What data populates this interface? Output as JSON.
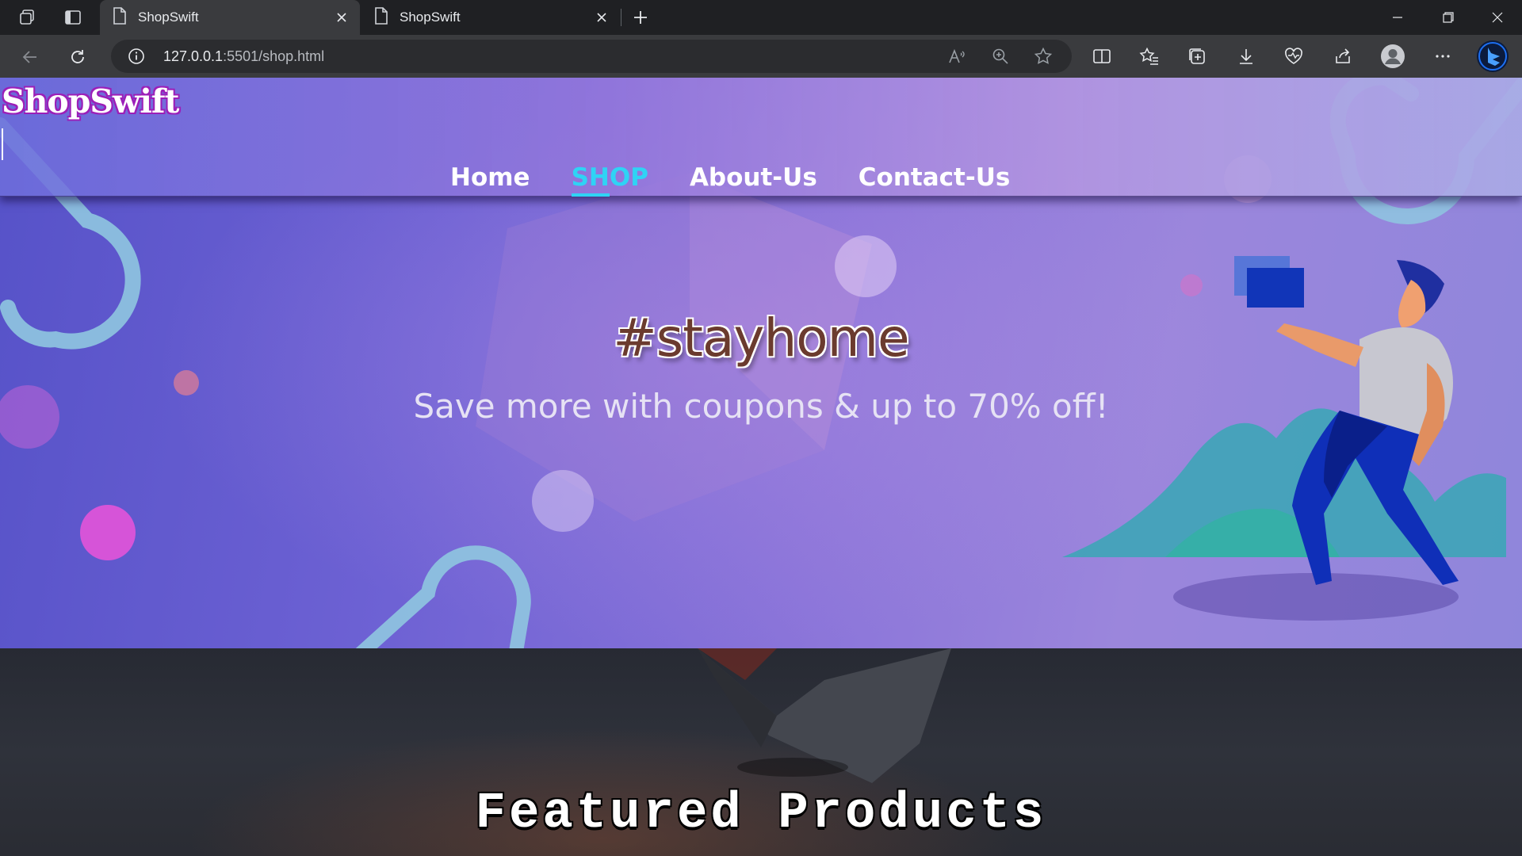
{
  "browser": {
    "tabs": [
      {
        "title": "ShopSwift",
        "active": true
      },
      {
        "title": "ShopSwift",
        "active": false
      }
    ],
    "url_host": "127.0.0.1",
    "url_path": ":5501/shop.html",
    "icons": [
      "workspaces-icon",
      "tab-actions-icon",
      "page-icon",
      "close-icon",
      "new-tab-icon",
      "minimize-icon",
      "restore-icon",
      "window-close-icon",
      "back-icon",
      "refresh-icon",
      "info-icon",
      "read-aloud-icon",
      "zoom-icon",
      "favorite-star-icon",
      "split-screen-icon",
      "favorites-icon",
      "collections-icon",
      "downloads-icon",
      "browser-essentials-icon",
      "share-icon",
      "profile-icon",
      "more-icon",
      "copilot-icon"
    ]
  },
  "site": {
    "logo": "ShopSwift",
    "nav": [
      {
        "label": "Home",
        "active": false
      },
      {
        "label": "SHOP",
        "active": true
      },
      {
        "label": "About-Us",
        "active": false
      },
      {
        "label": "Contact-Us",
        "active": false
      }
    ],
    "hero": {
      "title": "#stayhome",
      "subtitle": "Save more with coupons & up to 70% off!"
    },
    "featured_title": "Featured Products"
  },
  "colors": {
    "nav_active": "#2fd3f5",
    "logo_outline": "#9c1fb8",
    "hero_start": "#5652c8",
    "hero_end": "#8f86db"
  }
}
